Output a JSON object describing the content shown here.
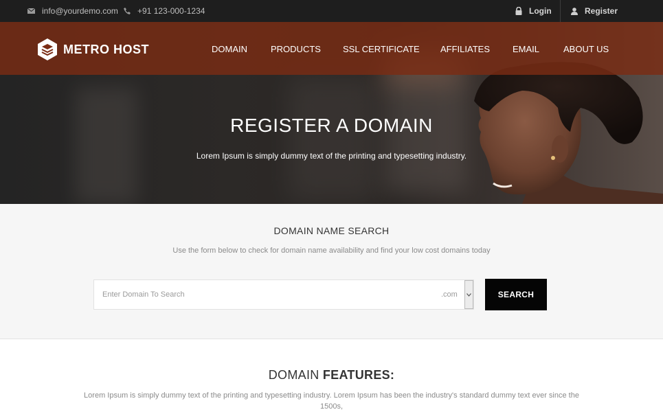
{
  "topbar": {
    "email": "info@yourdemo.com",
    "phone": "+91 123-000-1234",
    "login_label": "Login",
    "register_label": "Register",
    "email_icon": "envelope-icon",
    "phone_icon": "phone-icon",
    "login_icon": "lock-icon",
    "register_icon": "user-icon"
  },
  "brand": {
    "logo_text": "METRO HOST",
    "logo_icon": "stack-hexagon-icon"
  },
  "nav": {
    "items": [
      {
        "label": "DOMAIN"
      },
      {
        "label": "PRODUCTS"
      },
      {
        "label": "SSL CERTIFICATE"
      },
      {
        "label": "AFFILIATES"
      },
      {
        "label": "EMAIL"
      },
      {
        "label": "ABOUT US"
      }
    ]
  },
  "hero": {
    "title": "REGISTER A DOMAIN",
    "subtitle": "Lorem Ipsum is simply dummy text of the printing and typesetting industry."
  },
  "search": {
    "title": "DOMAIN NAME SEARCH",
    "description": "Use the form below to check for domain name availability and find your low cost domains today",
    "input_placeholder": "Enter Domain To Search",
    "tld_selected": ".com",
    "button_label": "SEARCH"
  },
  "features": {
    "title_light": "DOMAIN ",
    "title_bold": "FEATURES:",
    "text": "Lorem Ipsum is simply dummy text of the printing and typesetting industry. Lorem Ipsum has been the industry's standard dummy text ever since the 1500s,"
  },
  "colors": {
    "topbar_bg": "#1e1e1e",
    "nav_band": "#7a2c14",
    "search_bg": "#f6f6f6",
    "button_bg": "#050505"
  }
}
